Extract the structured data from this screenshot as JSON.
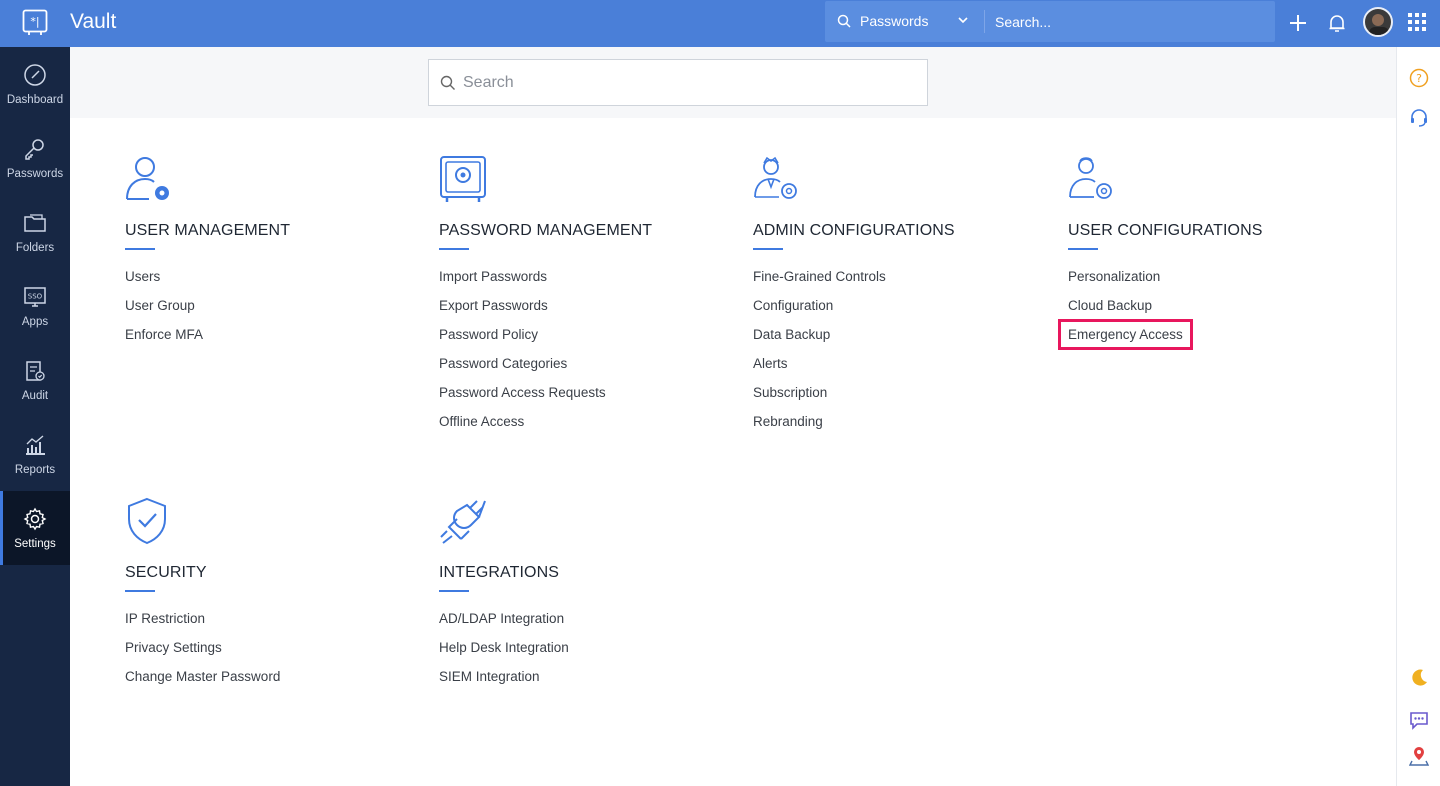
{
  "app": {
    "title": "Vault"
  },
  "topbar": {
    "scope_label": "Passwords",
    "search_placeholder": "Search..."
  },
  "sidebar": {
    "items": [
      {
        "label": "Dashboard",
        "icon": "dashboard-icon"
      },
      {
        "label": "Passwords",
        "icon": "keys-icon"
      },
      {
        "label": "Folders",
        "icon": "folder-icon"
      },
      {
        "label": "Apps",
        "icon": "sso-icon"
      },
      {
        "label": "Audit",
        "icon": "audit-icon"
      },
      {
        "label": "Reports",
        "icon": "reports-icon"
      },
      {
        "label": "Settings",
        "icon": "gear-icon",
        "active": true
      }
    ]
  },
  "page_search": {
    "placeholder": "Search"
  },
  "sections": [
    {
      "title": "USER MANAGEMENT",
      "icon": "user-gear-icon",
      "links": [
        "Users",
        "User Group",
        "Enforce MFA"
      ]
    },
    {
      "title": "PASSWORD MANAGEMENT",
      "icon": "safe-icon",
      "links": [
        "Import Passwords",
        "Export Passwords",
        "Password Policy",
        "Password Categories",
        "Password Access Requests",
        "Offline Access"
      ]
    },
    {
      "title": "ADMIN CONFIGURATIONS",
      "icon": "admin-gear-icon",
      "links": [
        "Fine-Grained Controls",
        "Configuration",
        "Data Backup",
        "Alerts",
        "Subscription",
        "Rebranding"
      ]
    },
    {
      "title": "USER CONFIGURATIONS",
      "icon": "user-config-icon",
      "links": [
        "Personalization",
        "Cloud Backup",
        "Emergency Access"
      ],
      "highlighted": "Emergency Access"
    },
    {
      "title": "SECURITY",
      "icon": "shield-check-icon",
      "links": [
        "IP Restriction",
        "Privacy Settings",
        "Change Master Password"
      ]
    },
    {
      "title": "INTEGRATIONS",
      "icon": "plug-icon",
      "links": [
        "AD/LDAP Integration",
        "Help Desk Integration",
        "SIEM Integration"
      ]
    }
  ],
  "colors": {
    "topbar": "#4a7fd8",
    "sidebar": "#172744",
    "accent": "#3f7ae0",
    "highlight": "#e8175d"
  }
}
